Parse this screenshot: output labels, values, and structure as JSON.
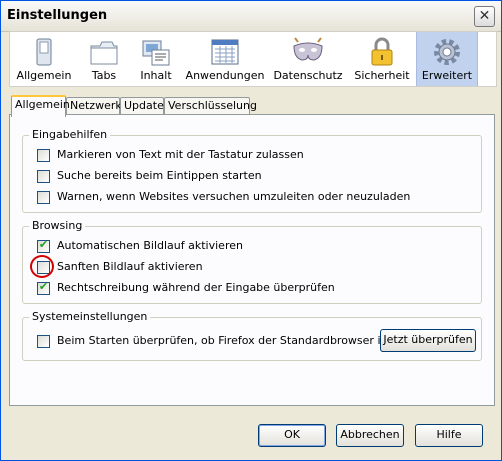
{
  "window": {
    "title": "Einstellungen",
    "close_glyph": "✕"
  },
  "toolbar": {
    "items": [
      {
        "label": "Allgemein",
        "icon": "switch-icon"
      },
      {
        "label": "Tabs",
        "icon": "tabs-icon"
      },
      {
        "label": "Inhalt",
        "icon": "content-icon"
      },
      {
        "label": "Anwendungen",
        "icon": "applications-icon"
      },
      {
        "label": "Datenschutz",
        "icon": "mask-icon"
      },
      {
        "label": "Sicherheit",
        "icon": "lock-icon"
      },
      {
        "label": "Erweitert",
        "icon": "gear-icon",
        "selected": true
      }
    ]
  },
  "tabs": [
    {
      "label": "Allgemein",
      "active": true
    },
    {
      "label": "Netzwerk"
    },
    {
      "label": "Update"
    },
    {
      "label": "Verschlüsselung"
    }
  ],
  "groups": {
    "eingabehilfen": {
      "title": "Eingabehilfen",
      "items": [
        {
          "label": "Markieren von Text mit der Tastatur zulassen",
          "checked": false
        },
        {
          "label": "Suche bereits beim Eintippen starten",
          "checked": false
        },
        {
          "label": "Warnen, wenn Websites versuchen umzuleiten oder neuzuladen",
          "checked": false
        }
      ]
    },
    "browsing": {
      "title": "Browsing",
      "items": [
        {
          "label": "Automatischen Bildlauf aktivieren",
          "checked": true
        },
        {
          "label": "Sanften Bildlauf aktivieren",
          "checked": false
        },
        {
          "label": "Rechtschreibung während der Eingabe überprüfen",
          "checked": true
        }
      ]
    },
    "system": {
      "title": "Systemeinstellungen",
      "checkbox_label": "Beim Starten überprüfen, ob Firefox der Standardbrowser ist",
      "checked": false,
      "button_label": "Jetzt überprüfen"
    }
  },
  "buttons": {
    "ok": "OK",
    "cancel": "Abbrechen",
    "help": "Hilfe"
  },
  "colors": {
    "accent": "#ffc83c",
    "selected_toolbar": "#c1d2ee",
    "highlight": "#d40000",
    "check": "#21a121"
  }
}
